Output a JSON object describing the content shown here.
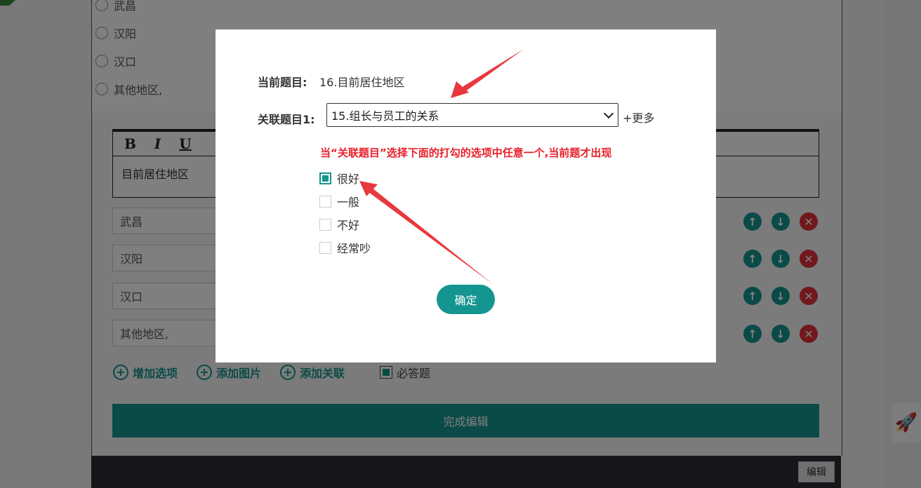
{
  "background": {
    "radio_options": [
      "武昌",
      "汉阳",
      "汉口",
      "其他地区,"
    ],
    "toolbar": {
      "bold": "B",
      "italic": "I",
      "underline": "U"
    },
    "question_text": "目前居住地区",
    "option_inputs": [
      "武昌",
      "汉阳",
      "汉口",
      "其他地区,"
    ],
    "links": {
      "add_option": "增加选项",
      "add_image": "添加图片",
      "add_relation": "添加关联"
    },
    "required_label": "必答题",
    "finish_label": "完成编辑",
    "edit_label": "编辑"
  },
  "modal": {
    "current_label": "当前题目:",
    "current_value": "16.目前居住地区",
    "related_label": "关联题目1:",
    "related_selected": "15.组长与员工的关系",
    "more_label": "+更多",
    "hint": "当“关联题目”选择下面的打勾的选项中任意一个,当前题才出现",
    "choices": [
      {
        "label": "很好",
        "checked": true
      },
      {
        "label": "一般",
        "checked": false
      },
      {
        "label": "不好",
        "checked": false
      },
      {
        "label": "经常吵",
        "checked": false
      }
    ],
    "ok_label": "确定"
  },
  "colors": {
    "accent": "#15958f",
    "danger": "#e0303c",
    "hint": "#e8202a",
    "arrow": "#e8383d"
  },
  "icons": [
    "arrow-up-icon",
    "arrow-down-icon",
    "close-icon",
    "plus-circle-icon",
    "rocket-icon",
    "chevron-down-icon"
  ]
}
